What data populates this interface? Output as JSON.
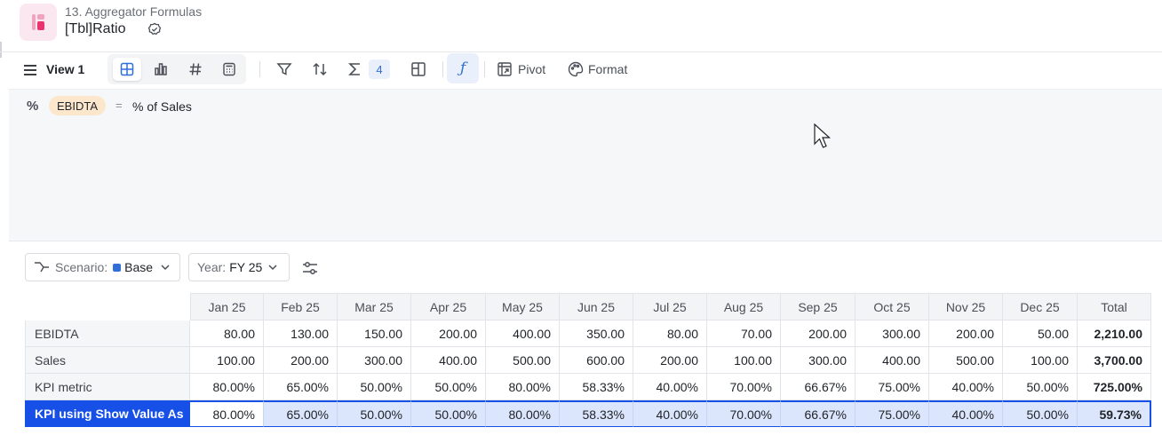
{
  "header": {
    "breadcrumb": "13. Aggregator Formulas",
    "title": "[Tbl]Ratio"
  },
  "toolbar": {
    "view_label": "View 1",
    "aggregations_count": "4",
    "pivot_label": "Pivot",
    "format_label": "Format",
    "fx_glyph": "ƒ"
  },
  "formula": {
    "prefix": "%",
    "token": "EBIDTA",
    "operator": "=",
    "expression": "% of Sales"
  },
  "filters": {
    "scenario_label": "Scenario:",
    "scenario_value": "Base",
    "year_label": "Year:",
    "year_value": "FY 25"
  },
  "table": {
    "columns": [
      "Jan 25",
      "Feb 25",
      "Mar 25",
      "Apr 25",
      "May 25",
      "Jun 25",
      "Jul 25",
      "Aug 25",
      "Sep 25",
      "Oct 25",
      "Nov 25",
      "Dec 25",
      "Total"
    ],
    "rows": [
      {
        "label": "EBIDTA",
        "values": [
          "80.00",
          "130.00",
          "150.00",
          "200.00",
          "400.00",
          "350.00",
          "80.00",
          "70.00",
          "200.00",
          "300.00",
          "200.00",
          "50.00",
          "2,210.00"
        ]
      },
      {
        "label": "Sales",
        "values": [
          "100.00",
          "200.00",
          "300.00",
          "400.00",
          "500.00",
          "600.00",
          "200.00",
          "100.00",
          "300.00",
          "400.00",
          "500.00",
          "100.00",
          "3,700.00"
        ]
      },
      {
        "label": "KPI metric",
        "values": [
          "80.00%",
          "65.00%",
          "50.00%",
          "50.00%",
          "80.00%",
          "58.33%",
          "40.00%",
          "70.00%",
          "66.67%",
          "75.00%",
          "40.00%",
          "50.00%",
          "725.00%"
        ]
      },
      {
        "label": "KPI using Show Value As",
        "values": [
          "80.00%",
          "65.00%",
          "50.00%",
          "50.00%",
          "80.00%",
          "58.33%",
          "40.00%",
          "70.00%",
          "66.67%",
          "75.00%",
          "40.00%",
          "50.00%",
          "59.73%"
        ]
      }
    ]
  },
  "colors": {
    "accent": "#2f6fd6",
    "selection": "#1750e6",
    "token_bg": "#fde7cc",
    "scenario_swatch": "#2f6fd6"
  },
  "icons": [
    "app-logo-icon",
    "certified-badge-icon",
    "hamburger-menu-icon",
    "grid-view-icon",
    "chart-view-icon",
    "kpi-number-icon",
    "calculator-view-icon",
    "filter-icon",
    "sort-icon",
    "sigma-icon",
    "layout-icon",
    "formula-fx-icon",
    "pivot-icon",
    "palette-icon",
    "scenario-icon",
    "chevron-down-icon",
    "sliders-icon",
    "mouse-cursor-icon"
  ]
}
